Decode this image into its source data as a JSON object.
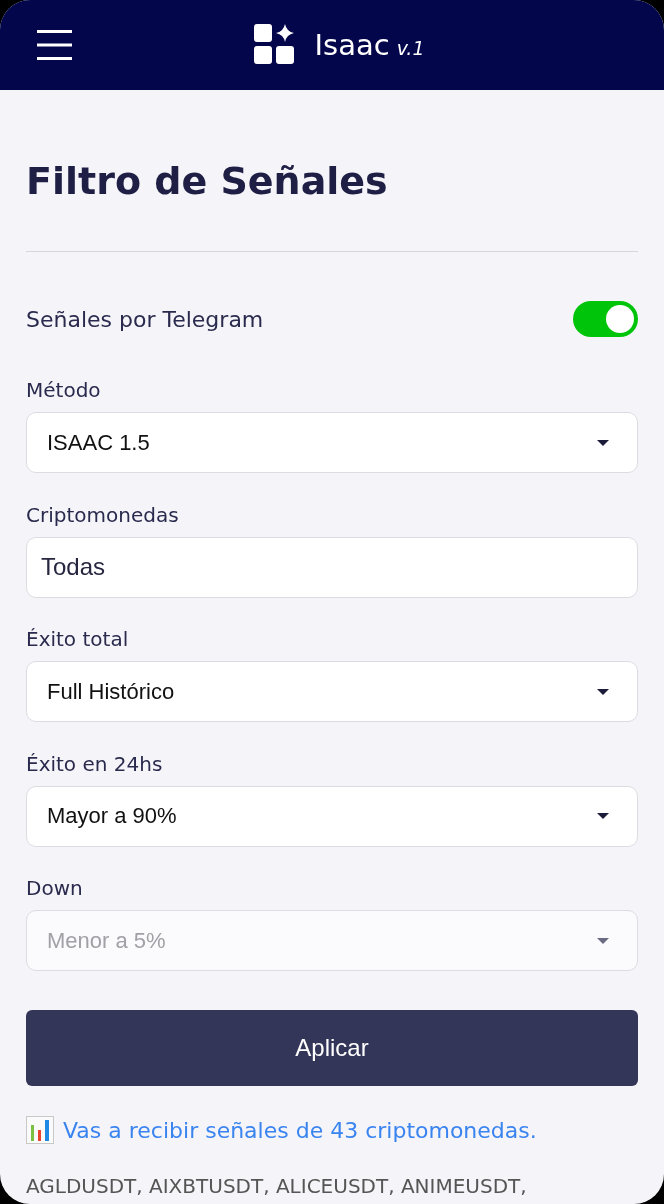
{
  "header": {
    "title": "Isaac",
    "version": "v.1"
  },
  "page_title": "Filtro de Señales",
  "telegram": {
    "label": "Señales por Telegram",
    "on": true
  },
  "fields": [
    {
      "kind": "select",
      "label": "Método",
      "value": "ISAAC 1.5",
      "disabled": false
    },
    {
      "kind": "text",
      "label": "Criptomonedas",
      "value": "Todas",
      "disabled": false
    },
    {
      "kind": "select",
      "label": "Éxito total",
      "value": "Full Histórico",
      "disabled": false
    },
    {
      "kind": "select",
      "label": "Éxito en 24hs",
      "value": "Mayor a 90%",
      "disabled": false
    },
    {
      "kind": "select",
      "label": "Down",
      "value": "Menor a 5%",
      "disabled": true
    }
  ],
  "apply_button": "Aplicar",
  "summary": "Vas a recibir señales de 43 criptomonedas.",
  "coins": "AGLDUSDT, AIXBTUSDT, ALICEUSDT, ANIMEUSDT,"
}
